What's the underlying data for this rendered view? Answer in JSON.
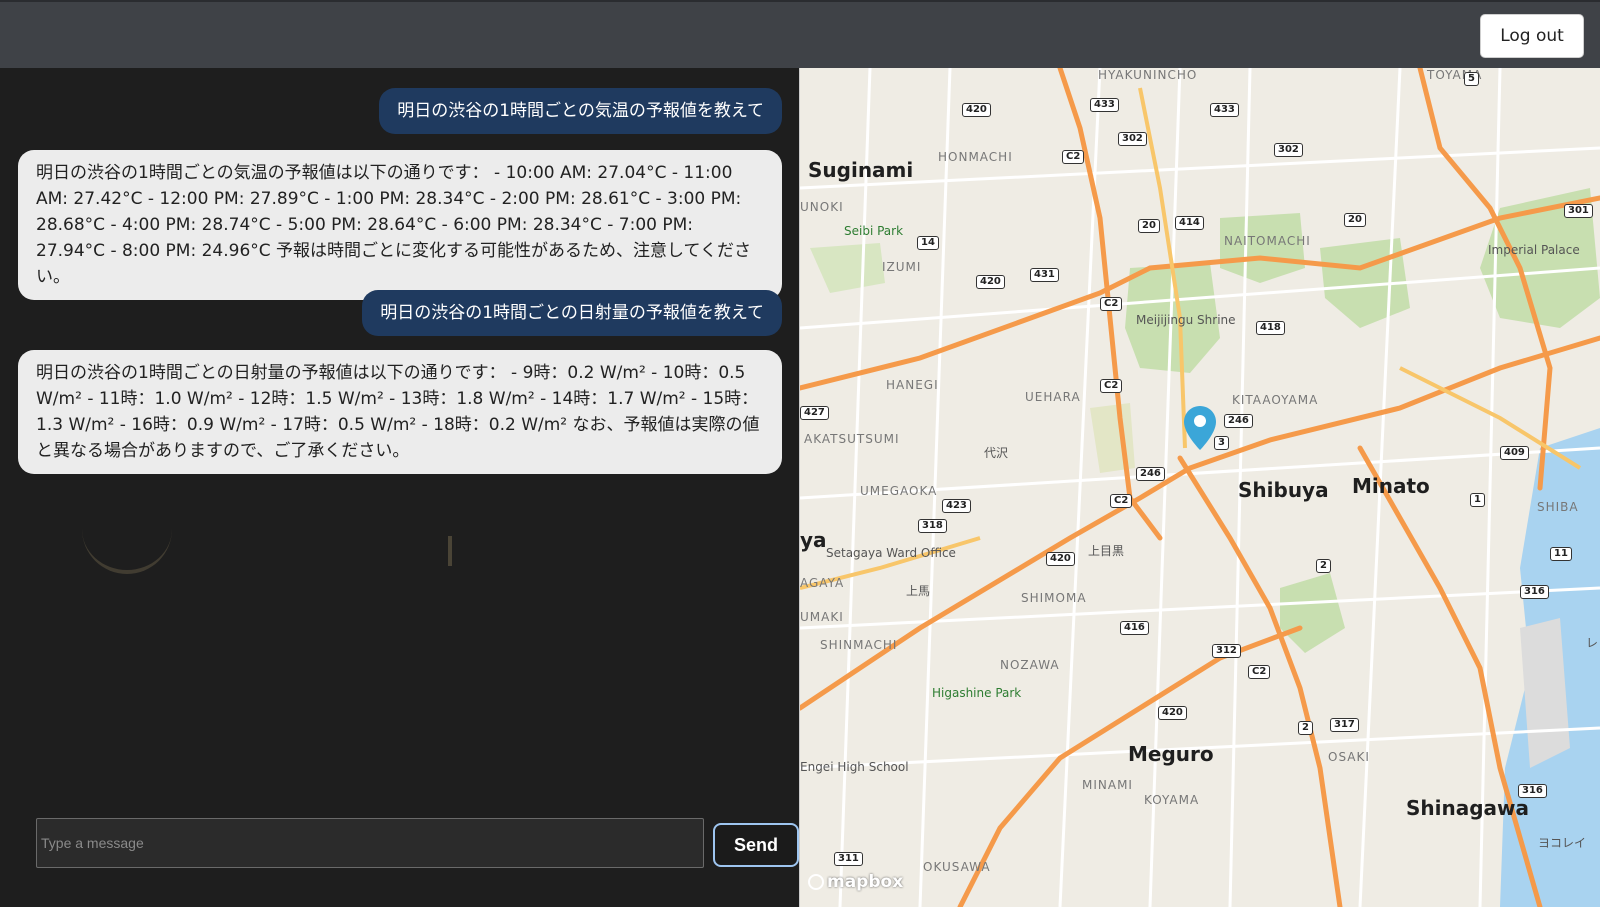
{
  "header": {
    "logout_label": "Log out"
  },
  "chat": {
    "messages": [
      {
        "role": "user",
        "text": "明日の渋谷の1時間ごとの気温の予報値を教えて"
      },
      {
        "role": "assistant",
        "text": "明日の渋谷の1時間ごとの気温の予報値は以下の通りです： - 10:00 AM: 27.04°C - 11:00 AM: 27.42°C - 12:00 PM: 27.89°C - 1:00 PM: 28.34°C - 2:00 PM: 28.61°C - 3:00 PM: 28.68°C - 4:00 PM: 28.74°C - 5:00 PM: 28.64°C - 6:00 PM: 28.34°C - 7:00 PM: 27.94°C - 8:00 PM: 24.96°C 予報は時間ごとに変化する可能性があるため、注意してください。"
      },
      {
        "role": "user",
        "text": "明日の渋谷の1時間ごとの日射量の予報値を教えて"
      },
      {
        "role": "assistant",
        "text": "明日の渋谷の1時間ごとの日射量の予報値は以下の通りです： - 9時：0.2 W/m² - 10時：0.5 W/m² - 11時：1.0 W/m² - 12時：1.5 W/m² - 13時：1.8 W/m² - 14時：1.7 W/m² - 15時：1.3 W/m² - 16時：0.9 W/m² - 17時：0.5 W/m² - 18時：0.2 W/m² なお、予報値は実際の値と異なる場合がありますので、ご了承ください。"
      }
    ],
    "input": {
      "placeholder": "Type a message",
      "value": ""
    },
    "send_label": "Send"
  },
  "map": {
    "attribution": "mapbox",
    "wards": {
      "suginami": "Suginami",
      "shibuya": "Shibuya",
      "minato": "Minato",
      "meguro": "Meguro",
      "shinagawa": "Shinagawa",
      "ya": "ya"
    },
    "districts": {
      "hyakunincho": "HYAKUNINCHO",
      "toyama": "TOYAMA",
      "honmachi": "HONMACHI",
      "unoki": "UNOKI",
      "izumi": "IZUMI",
      "naitomachi": "NAITOMACHI",
      "hanegi": "HANEGI",
      "uehara": "UEHARA",
      "kitaaoyama": "KITAAOYAMA",
      "akatsutsumi": "AKATSUTSUMI",
      "umegaoka": "UMEGAOKA",
      "shiba": "SHIBA",
      "agaya": "AGAYA",
      "umaki": "UMAKI",
      "shimoma": "SHIMOMA",
      "shinmachi": "SHINMACHI",
      "nozawa": "NOZAWA",
      "minami": "MINAMI",
      "koyama": "KOYAMA",
      "osaki": "OSAKI",
      "okusawa": "OKUSAWA"
    },
    "kanji": {
      "daizawa": "代沢",
      "kamimeguro": "上目黒",
      "kamiuma": "上馬",
      "yokorei": "ヨコレイ",
      "re": "レ"
    },
    "pois": {
      "seibi_park": "Seibi Park",
      "meiji_shrine": "Meijijingu Shrine",
      "imperial_palace": "Imperial Palace",
      "setagaya_office": "Setagaya Ward Office",
      "higashine_park": "Higashine Park",
      "engei_school": "Engei High School"
    },
    "road_shields": [
      "420",
      "433",
      "433",
      "302",
      "302",
      "C2",
      "14",
      "414",
      "20",
      "20",
      "431",
      "420",
      "C2",
      "418",
      "C2",
      "246",
      "3",
      "246",
      "C2",
      "423",
      "318",
      "420",
      "416",
      "312",
      "C2",
      "420",
      "2",
      "317",
      "2",
      "1",
      "409",
      "11",
      "316",
      "316",
      "311",
      "301",
      "5",
      "427"
    ],
    "marker": "location-pin"
  }
}
